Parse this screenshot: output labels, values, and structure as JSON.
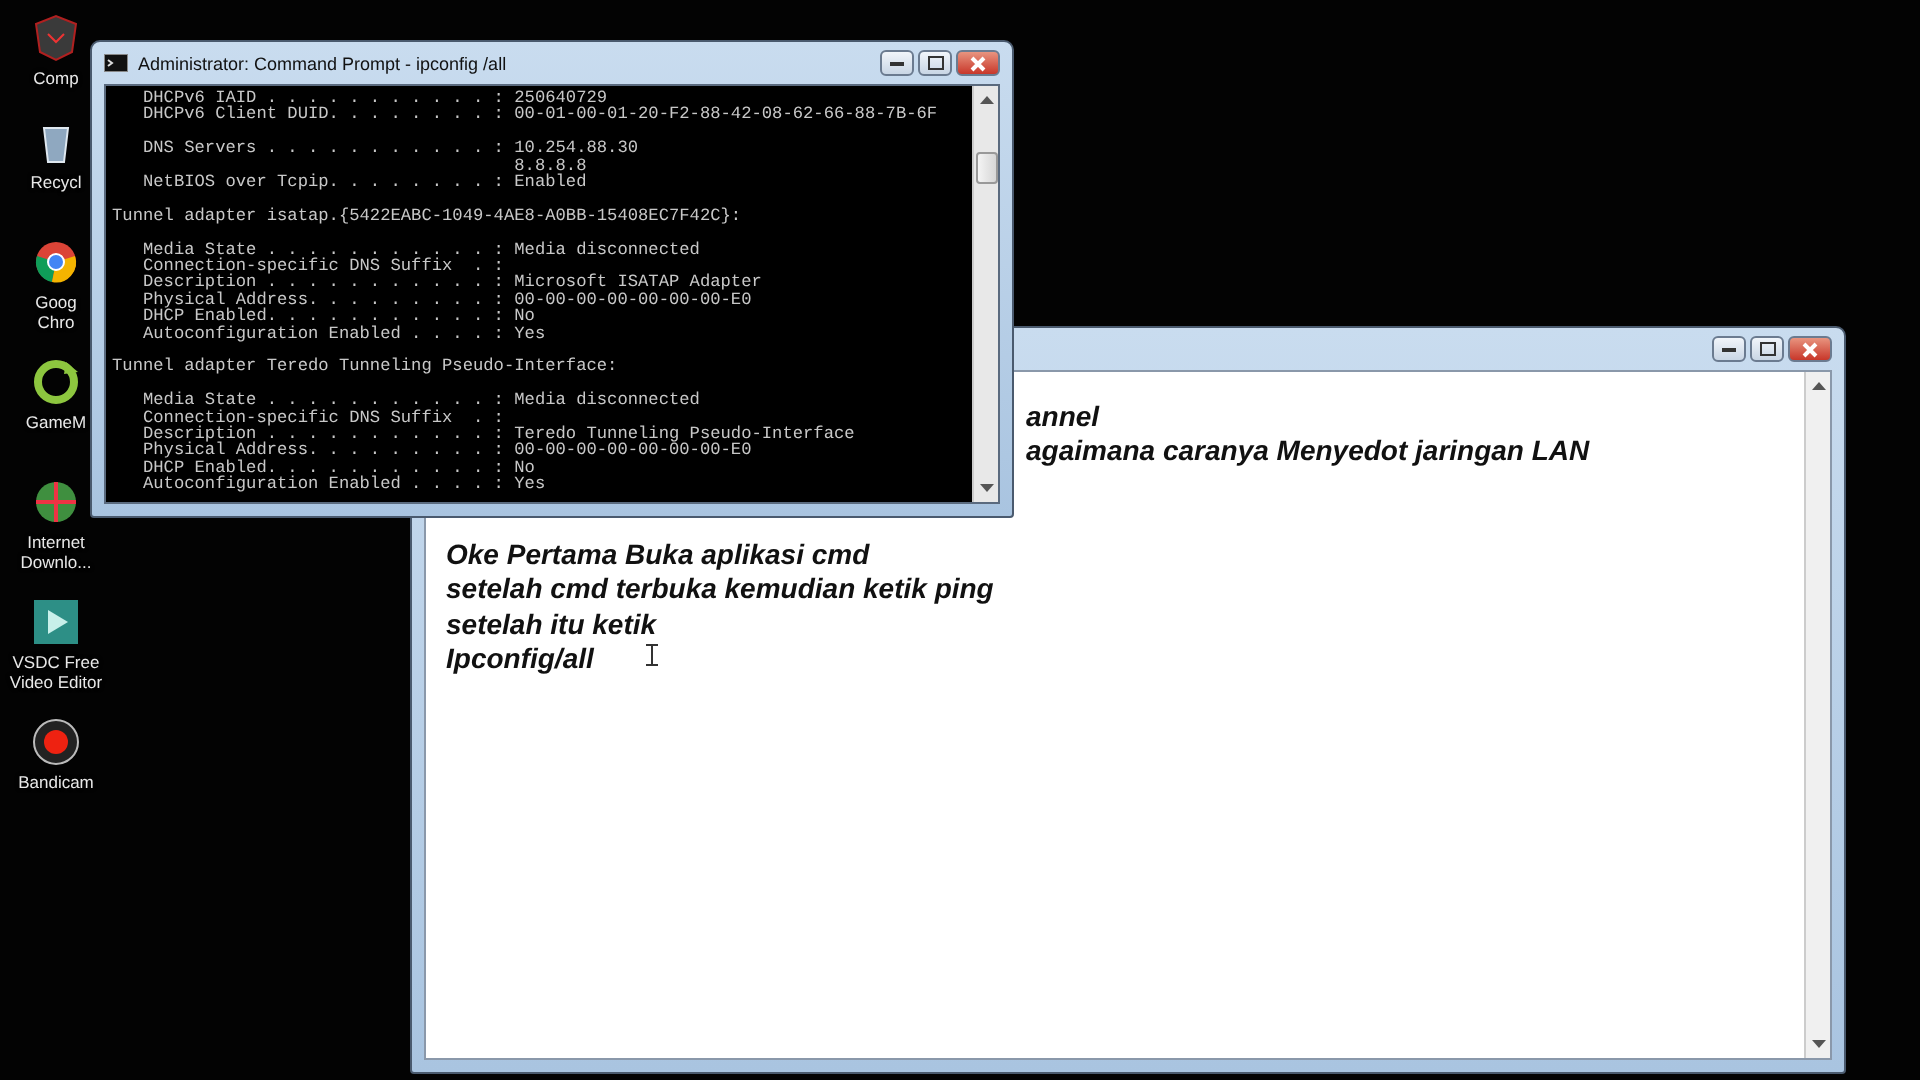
{
  "desktop": {
    "icons": [
      {
        "label": "Comp",
        "kind": "computer"
      },
      {
        "label": "Recycl",
        "kind": "bin"
      },
      {
        "label": "Goog\nChro",
        "kind": "browser"
      },
      {
        "label": "GameM",
        "kind": "game"
      },
      {
        "label": "Internet\nDownlo...",
        "kind": "download"
      },
      {
        "label": "VSDC Free\nVideo Editor",
        "kind": "video"
      },
      {
        "label": "Bandicam",
        "kind": "record"
      }
    ]
  },
  "command_prompt": {
    "title": "Administrator: Command Prompt - ipconfig /all",
    "blocks": [
      [
        "   DHCPv6 IAID . . . . . . . . . . . : 250640729",
        "   DHCPv6 Client DUID. . . . . . . . : 00-01-00-01-20-F2-88-42-08-62-66-88-7B-6F"
      ],
      [
        "   DNS Servers . . . . . . . . . . . : 10.254.88.30",
        "                                       8.8.8.8",
        "   NetBIOS over Tcpip. . . . . . . . : Enabled"
      ],
      [
        "Tunnel adapter isatap.{5422EABC-1049-4AE8-A0BB-15408EC7F42C}:"
      ],
      [
        "   Media State . . . . . . . . . . . : Media disconnected",
        "   Connection-specific DNS Suffix  . :",
        "   Description . . . . . . . . . . . : Microsoft ISATAP Adapter",
        "   Physical Address. . . . . . . . . : 00-00-00-00-00-00-00-E0",
        "   DHCP Enabled. . . . . . . . . . . : No",
        "   Autoconfiguration Enabled . . . . : Yes"
      ],
      [
        "Tunnel adapter Teredo Tunneling Pseudo-Interface:"
      ],
      [
        "   Media State . . . . . . . . . . . : Media disconnected",
        "   Connection-specific DNS Suffix  . :",
        "   Description . . . . . . . . . . . : Teredo Tunneling Pseudo-Interface",
        "   Physical Address. . . . . . . . . : 00-00-00-00-00-00-00-E0",
        "   DHCP Enabled. . . . . . . . . . . : No",
        "   Autoconfiguration Enabled . . . . : Yes"
      ]
    ]
  },
  "notepad": {
    "lines": [
      {
        "text": "annel",
        "kind": "partial"
      },
      {
        "text": "agaimana caranya Menyedot jaringan LAN",
        "kind": "partial"
      },
      {
        "kind": "blank"
      },
      {
        "kind": "blank"
      },
      {
        "text": "Oke Pertama Buka aplikasi cmd",
        "kind": "line"
      },
      {
        "text": "setelah cmd terbuka kemudian ketik ping",
        "kind": "line"
      },
      {
        "text": "setelah itu ketik",
        "kind": "line"
      },
      {
        "text": "Ipconfig/all",
        "kind": "line"
      }
    ]
  }
}
